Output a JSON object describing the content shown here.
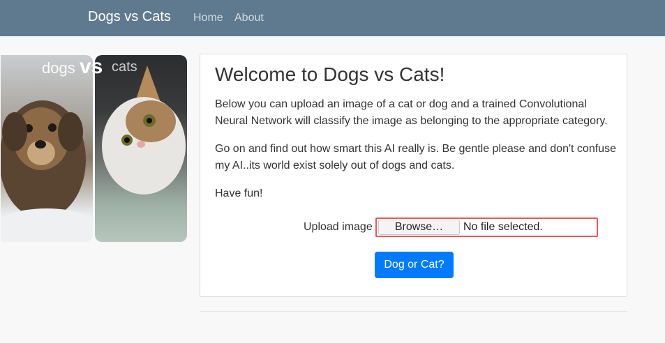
{
  "nav": {
    "brand": "Dogs vs Cats",
    "links": [
      "Home",
      "About"
    ],
    "background": "#5f7a8e"
  },
  "hero": {
    "dogs_text": "dogs",
    "vs_text": "vs",
    "cats_text": "cats"
  },
  "card": {
    "title": "Welcome to Dogs vs Cats!",
    "paragraphs": [
      "Below you can upload an image of a cat or dog and a trained Convolutional Neural Network will classify the image as belonging to the appropriate category.",
      "Go on and find out how smart this AI really is. Be gentle please and don't confuse my AI..its world exist solely out of dogs and cats.",
      "Have fun!"
    ],
    "upload_label": "Upload image",
    "browse_label": "Browse…",
    "file_status": "No file selected.",
    "submit_label": "Dog or Cat?",
    "submit_color": "#007bff",
    "input_border_color": "#e9565d"
  }
}
